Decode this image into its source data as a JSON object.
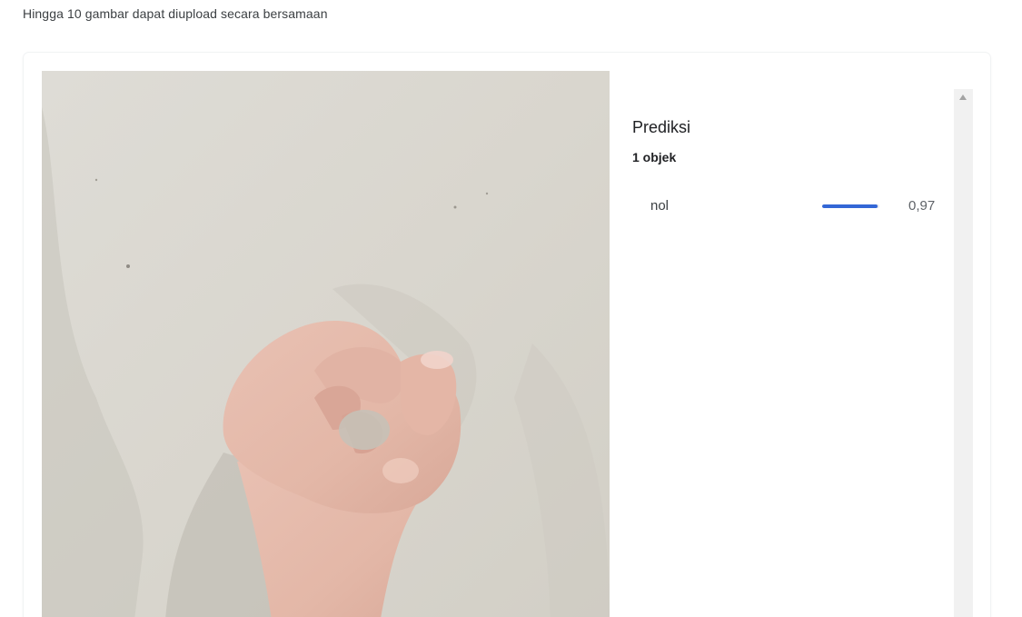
{
  "hint_text": "Hingga 10 gambar dapat diupload secara bersamaan",
  "image": {
    "icon": "uploaded-hand-photo"
  },
  "results": {
    "title": "Prediksi",
    "count": "1 objek",
    "predictions": [
      {
        "label": "nol",
        "score_text": "0,97",
        "score": 0.97
      }
    ],
    "bar_color": "#3367d6"
  },
  "scrollbar": {
    "icon": "scroll-up-arrow-icon"
  }
}
